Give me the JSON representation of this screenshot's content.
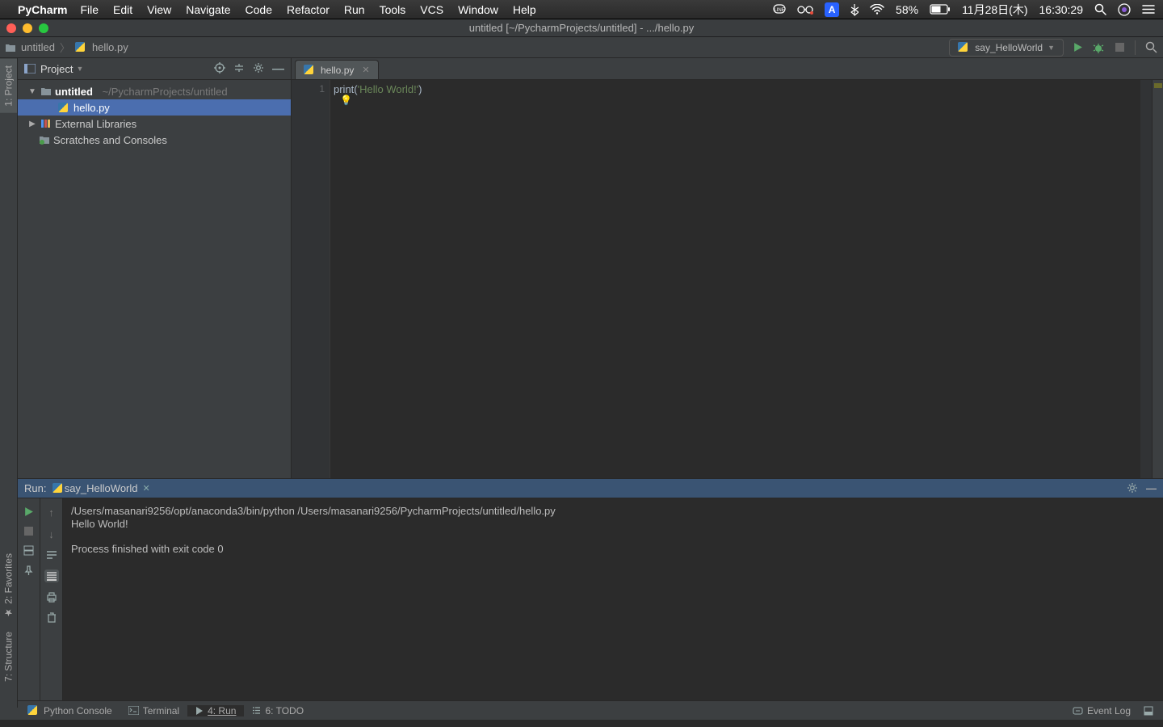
{
  "mac": {
    "app": "PyCharm",
    "menus": [
      "File",
      "Edit",
      "View",
      "Navigate",
      "Code",
      "Refactor",
      "Run",
      "Tools",
      "VCS",
      "Window",
      "Help"
    ],
    "battery": "58%",
    "date": "11月28日(木)",
    "time": "16:30:29",
    "input_badge": "A"
  },
  "window": {
    "title": "untitled [~/PycharmProjects/untitled] - .../hello.py"
  },
  "breadcrumb": {
    "root": "untitled",
    "file": "hello.py"
  },
  "run_config": {
    "name": "say_HelloWorld"
  },
  "project_panel": {
    "title": "Project",
    "tree": {
      "root_name": "untitled",
      "root_path": "~/PycharmProjects/untitled",
      "file": "hello.py",
      "ext_libs": "External Libraries",
      "scratches": "Scratches and Consoles"
    }
  },
  "editor": {
    "tab": "hello.py",
    "line_no": "1",
    "code_fn": "print",
    "code_open": "(",
    "code_str": "'Hello World!'",
    "code_close": ")"
  },
  "run_panel": {
    "label": "Run:",
    "config": "say_HelloWorld",
    "line1": "/Users/masanari9256/opt/anaconda3/bin/python /Users/masanari9256/PycharmProjects/untitled/hello.py",
    "line2": "Hello World!",
    "line3": "Process finished with exit code 0"
  },
  "bottom": {
    "python_console": "Python Console",
    "terminal": "Terminal",
    "run": "4: Run",
    "todo": "6: TODO",
    "event_log": "Event Log"
  },
  "rails": {
    "project": "1: Project",
    "favorites": "2: Favorites",
    "structure": "7: Structure"
  }
}
